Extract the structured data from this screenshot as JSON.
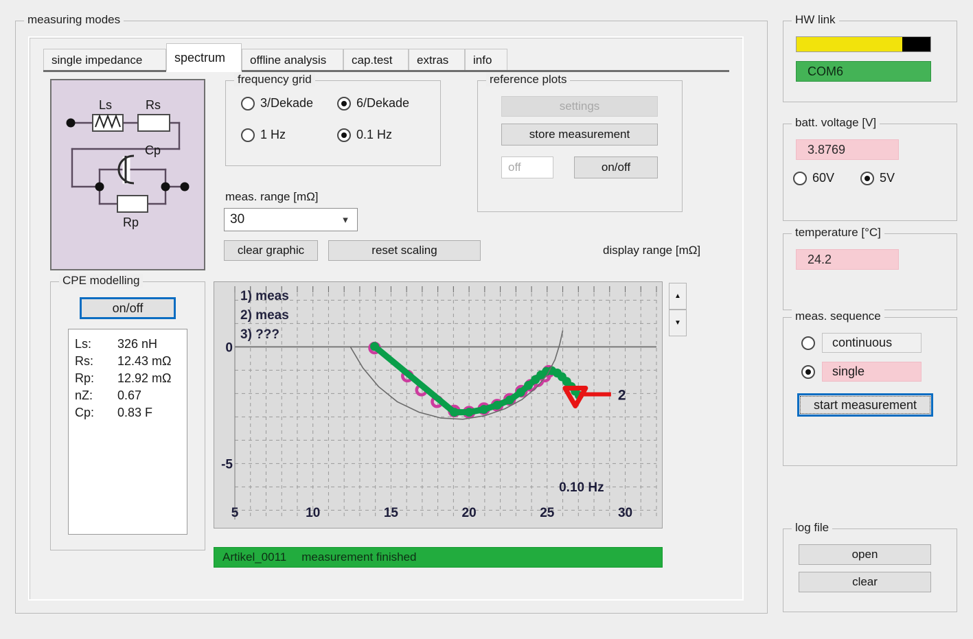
{
  "window": {
    "outer_group_title": "measuring modes"
  },
  "tabs": [
    {
      "label": "single impedance",
      "active": false
    },
    {
      "label": "spectrum",
      "active": true
    },
    {
      "label": "offline analysis",
      "active": false
    },
    {
      "label": "cap.test",
      "active": false
    },
    {
      "label": "extras",
      "active": false
    },
    {
      "label": "info",
      "active": false
    }
  ],
  "circuit": {
    "labels": {
      "ls": "Ls",
      "rs": "Rs",
      "cp": "Cp",
      "rp": "Rp"
    },
    "background": "#ddd2e2"
  },
  "frequency_grid": {
    "title": "frequency grid",
    "options": [
      {
        "label": "3/Dekade",
        "selected": false
      },
      {
        "label": "6/Dekade",
        "selected": true
      },
      {
        "label": "1 Hz",
        "selected": false
      },
      {
        "label": "0.1 Hz",
        "selected": true
      }
    ]
  },
  "reference_plots": {
    "title": "reference plots",
    "settings_label": "settings",
    "store_label": "store measurement",
    "state_value": "off",
    "onoff_label": "on/off"
  },
  "meas_range": {
    "label": "meas. range [mΩ]",
    "value": "30",
    "chevron": "chevron-down-icon"
  },
  "graph_buttons": {
    "clear_graphic": "clear graphic",
    "reset_scaling": "reset scaling",
    "display_range_label": "display range [mΩ]"
  },
  "cpe": {
    "title": "CPE modelling",
    "onoff_label": "on/off",
    "values": [
      {
        "key": "Ls:",
        "value": "326 nH"
      },
      {
        "key": "Rs:",
        "value": "12.43 mΩ"
      },
      {
        "key": "Rp:",
        "value": "12.92 mΩ"
      },
      {
        "key": "nZ:",
        "value": "0.67"
      },
      {
        "key": "Cp:",
        "value": "0.83 F"
      }
    ]
  },
  "chart_data": {
    "type": "scatter",
    "title": "",
    "xlabel": "",
    "ylabel": "",
    "xlim": [
      5,
      32
    ],
    "ylim": [
      -7.4,
      2.6
    ],
    "xticks": [
      5,
      10,
      15,
      20,
      25,
      30
    ],
    "xticklabels": [
      "5",
      "10",
      "15",
      "20",
      "25",
      "30"
    ],
    "yticks": [
      -5,
      0
    ],
    "yticklabels": [
      "-5",
      "0"
    ],
    "grid": true,
    "grid_style": "dashed",
    "legend_position": "top-left",
    "legend": [
      "1) meas",
      "2) meas",
      "3) ???"
    ],
    "annotations": [
      {
        "text": "0.10 Hz",
        "x": 27.2,
        "y": -6.2
      },
      {
        "text": "2",
        "x": 28.3,
        "y": -2.15,
        "marker": "red-triangle-cursor"
      }
    ],
    "series": [
      {
        "name": "1) meas",
        "color": "#cc3c9e",
        "marker": "circle-open",
        "points": [
          [
            13.95,
            -0.05
          ],
          [
            16.05,
            -1.25
          ],
          [
            16.95,
            -1.85
          ],
          [
            17.95,
            -2.35
          ],
          [
            19.05,
            -2.75
          ],
          [
            20.0,
            -2.8
          ],
          [
            20.95,
            -2.65
          ],
          [
            21.8,
            -2.5
          ],
          [
            22.6,
            -2.25
          ],
          [
            23.35,
            -1.9
          ],
          [
            23.95,
            -1.65
          ],
          [
            24.4,
            -1.45
          ],
          [
            24.85,
            -1.25
          ],
          [
            25.1,
            -1.05
          ]
        ]
      },
      {
        "name": "2) meas",
        "color": "#0a9e4a",
        "marker": "circle-filled",
        "points": [
          [
            13.95,
            0.02
          ],
          [
            19.05,
            -2.8
          ],
          [
            20.0,
            -2.8
          ],
          [
            20.95,
            -2.68
          ],
          [
            21.8,
            -2.5
          ],
          [
            22.6,
            -2.28
          ],
          [
            23.3,
            -1.95
          ],
          [
            23.8,
            -1.65
          ],
          [
            24.25,
            -1.4
          ],
          [
            24.6,
            -1.2
          ],
          [
            24.95,
            -1.05
          ],
          [
            25.3,
            -1.02
          ],
          [
            25.65,
            -1.12
          ],
          [
            25.95,
            -1.28
          ],
          [
            26.25,
            -1.48
          ],
          [
            26.55,
            -1.7
          ],
          [
            26.8,
            -1.9
          ],
          [
            27.05,
            -2.08
          ]
        ]
      },
      {
        "name": "3) ???",
        "color": "#6b6b6b",
        "marker": "line",
        "points": [
          [
            12.4,
            0.0
          ],
          [
            13.2,
            -0.9
          ],
          [
            14.2,
            -1.7
          ],
          [
            15.4,
            -2.35
          ],
          [
            16.8,
            -2.8
          ],
          [
            18.2,
            -3.05
          ],
          [
            19.6,
            -3.1
          ],
          [
            21.0,
            -2.95
          ],
          [
            22.3,
            -2.65
          ],
          [
            23.4,
            -2.25
          ],
          [
            24.3,
            -1.75
          ],
          [
            25.0,
            -1.2
          ],
          [
            25.5,
            -0.55
          ],
          [
            25.8,
            0.1
          ],
          [
            26.0,
            0.7
          ]
        ]
      }
    ]
  },
  "plot_spinner": {
    "up": "spinner-up-arrow",
    "down": "spinner-down-arrow"
  },
  "status": {
    "name": "Artikel_0011",
    "message": "measurement finished",
    "color": "#22ac3e"
  },
  "hw_link": {
    "title": "HW link",
    "bar_fill_percent": 79,
    "bar_fill_color": "#f2e30c",
    "bar_bg_color": "#000000",
    "com_port": "COM6",
    "com_color": "#44b356"
  },
  "batt_voltage": {
    "title": "batt. voltage [V]",
    "value": "3.8769",
    "options": [
      {
        "label": "60V",
        "selected": false
      },
      {
        "label": "5V",
        "selected": true
      }
    ]
  },
  "temperature": {
    "title": "temperature [°C]",
    "value": "24.2"
  },
  "meas_sequence": {
    "title": "meas. sequence",
    "options": [
      {
        "label": "continuous",
        "selected": false
      },
      {
        "label": "single",
        "selected": true
      }
    ],
    "start_label": "start measurement"
  },
  "log_file": {
    "title": "log file",
    "open_label": "open",
    "clear_label": "clear"
  }
}
